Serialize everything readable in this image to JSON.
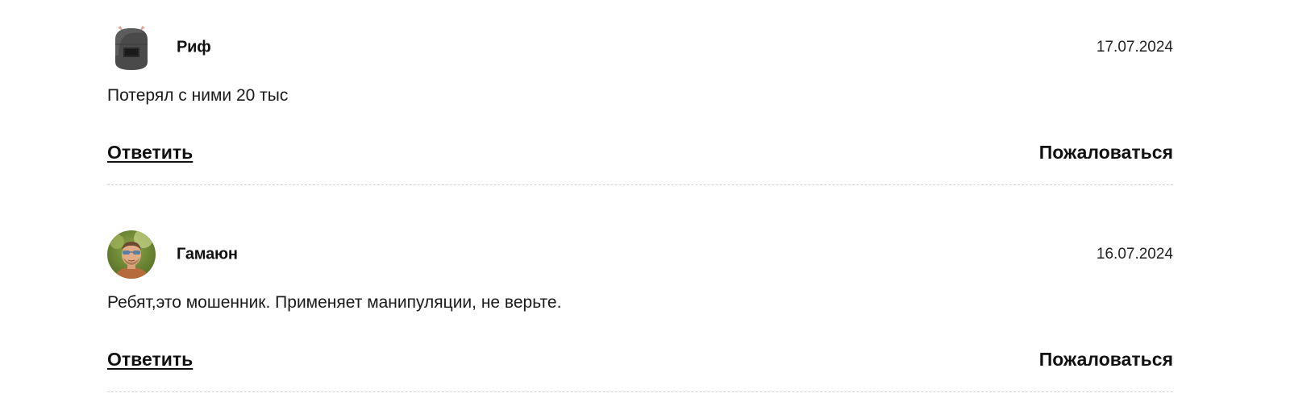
{
  "comments": [
    {
      "author": "Риф",
      "date": "17.07.2024",
      "text": "Потерял с ними 20 тыс",
      "reply_label": "Ответить",
      "report_label": "Пожаловаться",
      "avatar_icon": "welding-helmet-avatar"
    },
    {
      "author": "Гамаюн",
      "date": "16.07.2024",
      "text": "Ребят,это мошенник. Применяет манипуляции, не верьте.",
      "reply_label": "Ответить",
      "report_label": "Пожаловаться",
      "avatar_icon": "user-photo-avatar"
    }
  ]
}
